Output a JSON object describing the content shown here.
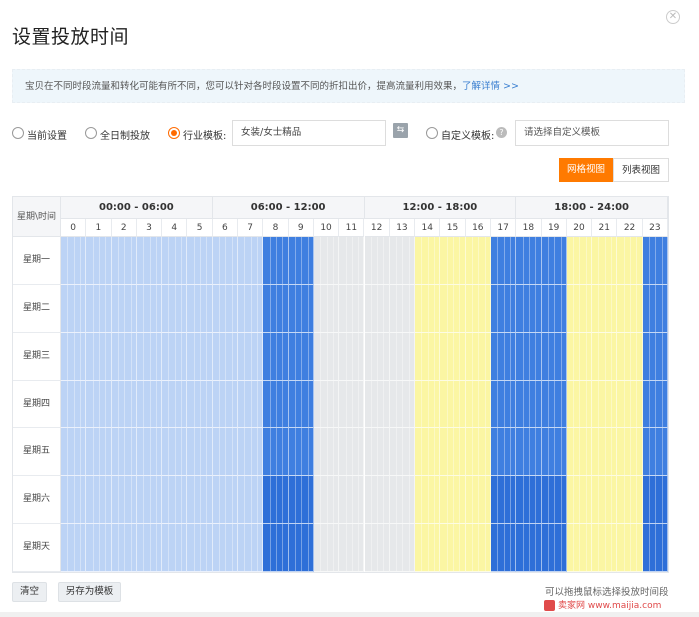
{
  "dialog": {
    "title": "设置投放时间",
    "close_label": "✕"
  },
  "notice": {
    "text": "宝贝在不同时段流量和转化可能有所不同，您可以针对各时段设置不同的折扣出价，提高流量利用效果，",
    "link": "了解详情 >>"
  },
  "options": {
    "current": "当前设置",
    "fullday": "全日制投放",
    "industry": "行业模板:",
    "industry_value": "女装/女士精品",
    "custom": "自定义模板:",
    "custom_placeholder": "请选择自定义模板",
    "selected": "industry"
  },
  "view_toggle": {
    "grid": "网格视图",
    "list": "列表视图",
    "active": "grid"
  },
  "grid": {
    "corner_label": "星期\\时间",
    "ranges": [
      "00:00 - 06:00",
      "06:00 - 12:00",
      "12:00 - 18:00",
      "18:00 - 24:00"
    ],
    "hours": [
      "0",
      "1",
      "2",
      "3",
      "4",
      "5",
      "6",
      "7",
      "8",
      "9",
      "10",
      "11",
      "12",
      "13",
      "14",
      "15",
      "16",
      "17",
      "18",
      "19",
      "20",
      "21",
      "22",
      "23"
    ],
    "days": [
      "星期一",
      "星期二",
      "星期三",
      "星期四",
      "星期五",
      "星期六",
      "星期天"
    ],
    "hour_levels": [
      1,
      1,
      1,
      1,
      1,
      1,
      1,
      1,
      3,
      3,
      0,
      0,
      0,
      0,
      2,
      2,
      2,
      3,
      3,
      3,
      2,
      2,
      2,
      3
    ],
    "level_colors": [
      "#e6e8ea",
      "#bcd3f5",
      "#fbf6a3",
      "#3f7fe0"
    ],
    "weekend_level3_color": "#2e6fd8"
  },
  "footer": {
    "clear": "清空",
    "save_as": "另存为模板",
    "hint": "可以拖拽鼠标选择投放时间段",
    "watermark": "卖家网 www.maijia.com"
  }
}
